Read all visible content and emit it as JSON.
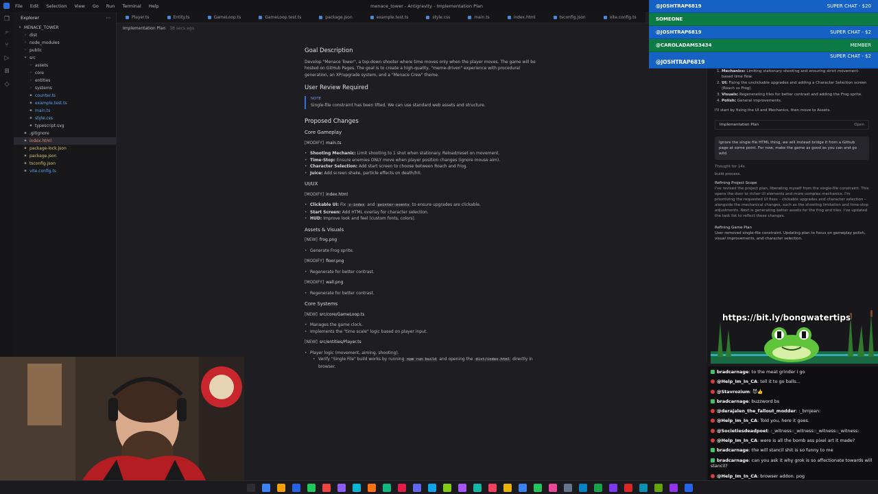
{
  "window": {
    "title": "menace_tower - Antigravity - Implementation Plan",
    "menu": [
      "File",
      "Edit",
      "Selection",
      "View",
      "Go",
      "Run",
      "Terminal",
      "Help"
    ]
  },
  "sidebar": {
    "header": "Explorer",
    "root": "MENACE_TOWER",
    "items": [
      {
        "label": "dist",
        "depth": 1,
        "kind": "folder"
      },
      {
        "label": "node_modules",
        "depth": 1,
        "kind": "folder"
      },
      {
        "label": "public",
        "depth": 1,
        "kind": "folder"
      },
      {
        "label": "src",
        "depth": 1,
        "kind": "folder-open"
      },
      {
        "label": "assets",
        "depth": 2,
        "kind": "folder"
      },
      {
        "label": "core",
        "depth": 2,
        "kind": "folder"
      },
      {
        "label": "entities",
        "depth": 2,
        "kind": "folder"
      },
      {
        "label": "systems",
        "depth": 2,
        "kind": "folder"
      },
      {
        "label": "counter.ts",
        "depth": 2,
        "kind": "ts"
      },
      {
        "label": "example.test.ts",
        "depth": 2,
        "kind": "ts"
      },
      {
        "label": "main.ts",
        "depth": 2,
        "kind": "ts"
      },
      {
        "label": "style.css",
        "depth": 2,
        "kind": "css"
      },
      {
        "label": "typescript.svg",
        "depth": 2,
        "kind": "svg"
      },
      {
        "label": ".gitignore",
        "depth": 1,
        "kind": "file"
      },
      {
        "label": "index.html",
        "depth": 1,
        "kind": "html",
        "selected": true
      },
      {
        "label": "package-lock.json",
        "depth": 1,
        "kind": "json"
      },
      {
        "label": "package.json",
        "depth": 1,
        "kind": "json"
      },
      {
        "label": "tsconfig.json",
        "depth": 1,
        "kind": "json"
      },
      {
        "label": "vite.config.ts",
        "depth": 1,
        "kind": "ts"
      }
    ]
  },
  "tabs": [
    "Player.ts",
    "Entity.ts",
    "GameLoop.ts",
    "GameLoop.test.ts",
    "package.json",
    "example.test.ts",
    "style.css",
    "main.ts",
    "index.html",
    "tsconfig.json",
    "vite.config.ts",
    "Implementation"
  ],
  "active_tab": 11,
  "breadcrumb": {
    "label": "Implementation Plan",
    "ago": "38 secs ago"
  },
  "doc": {
    "goal_title": "Goal Description",
    "goal_text": "Develop \"Menace Tower\", a top-down shooter where time moves only when the player moves. The game will be hosted on GitHub Pages. The goal is to create a high-quality, \"meme-driven\" experience with procedural generation, an XP/upgrade system, and a \"Menace Crew\" theme.",
    "review_title": "User Review Required",
    "note_label": "NOTE",
    "note_text": "Single-file constraint has been lifted. We can use standard web assets and structure.",
    "proposed_title": "Proposed Changes",
    "core_title": "Core Gameplay",
    "core_mod": {
      "tag": "[MODIFY]",
      "file": "main.ts"
    },
    "core_items": [
      {
        "b": "Shooting Mechanic:",
        "t": " Limit shooting to 1 shot when stationary. Reload/reset on movement."
      },
      {
        "b": "Time-Stop:",
        "t": " Ensure enemies ONLY move when player position changes (ignore mouse aim)."
      },
      {
        "b": "Character Selection:",
        "t": " Add start screen to choose between Roach and Frog."
      },
      {
        "b": "Juice:",
        "t": " Add screen shake, particle effects on death/hit."
      }
    ],
    "ui_title": "UI/UX",
    "ui_mod": {
      "tag": "[MODIFY]",
      "file": "index.html"
    },
    "ui_items": [
      {
        "b": "Clickable UI:",
        "t1": " Fix ",
        "c1": "z-index",
        "t2": " and ",
        "c2": "pointer-events",
        "t3": " to ensure upgrades are clickable."
      },
      {
        "b": "Start Screen:",
        "t": " Add HTML overlay for character selection."
      },
      {
        "b": "HUD:",
        "t": " Improve look and feel (custom fonts, colors)."
      }
    ],
    "assets_title": "Assets & Visuals",
    "assets": [
      {
        "tag": "[NEW]",
        "file": "frog.png",
        "item": "Generate Frog sprite."
      },
      {
        "tag": "[MODIFY]",
        "file": "floor.png",
        "item": "Regenerate for better contrast."
      },
      {
        "tag": "[MODIFY]",
        "file": "wall.png",
        "item": "Regenerate for better contrast."
      }
    ],
    "systems_title": "Core Systems",
    "gameloop": {
      "tag": "[NEW]",
      "file": "src/core/GameLoop.ts",
      "items": [
        "Manages the game clock.",
        "Implements the \"time scale\" logic based on player input."
      ]
    },
    "player": {
      "tag": "[NEW]",
      "file": "src/entities/Player.ts",
      "item": "Player logic (movement, aiming, shooting)."
    },
    "verify": {
      "t1": "Verify \"Single File\" build works by running ",
      "c": "npm run build",
      "t2": " and opening the ",
      "file": "dist/index.html",
      "t3": " directly in browser."
    }
  },
  "agent": {
    "steps": [
      {
        "b": "Mechanics:",
        "t": " Limiting stationary shooting and ensuring strict movement-based time flow."
      },
      {
        "b": "UI:",
        "t": " Fixing the unclickable upgrades and adding a Character Selection screen (Roach vs Frog)."
      },
      {
        "b": "Visuals:",
        "t": " Regenerating tiles for better contrast and adding the Frog sprite."
      },
      {
        "b": "Polish:",
        "t": " General improvements."
      }
    ],
    "closing": "I'll start by fixing the UI and Mechanics, then move to Assets.",
    "card_label": "Implementation Plan",
    "card_open": "Open",
    "user_msg": "Ignore the single file HTML thing, we will instead bridge it from a Github page at some point. For now, make the game as good as you can and go wild.",
    "thought": "Thought for 14s",
    "build_text": "build process.",
    "refine_scope_title": "Refining Project Scope",
    "refine_scope_text": "I've revised the project plan, liberating myself from the single-file constraint. This opens the door to richer UI elements and more complex mechanics. I'm prioritizing the requested UI fixes – clickable upgrades and character selection – alongside the mechanical changes, such as the shooting limitation and time-stop adjustments. Next is generating better assets for the frog and tiles. I've updated the task list to reflect these changes.",
    "refine_plan_title": "Refining Game Plan",
    "refine_plan_text": "User removed single-file constraint. Updating plan to focus on gameplay polish, visual improvements, and character selection."
  },
  "superchats": [
    {
      "name": "@JOSHTRAP6819",
      "label": "SUPER CHAT - $20",
      "kind": "super"
    },
    {
      "name": "SOMEONE",
      "label": "",
      "kind": "member"
    },
    {
      "name": "@JOSHTRAP6819",
      "label": "SUPER CHAT - $2",
      "kind": "super"
    },
    {
      "name": "@CAROLADAMS3434",
      "label": "MEMBER",
      "kind": "member"
    },
    {
      "name": "@JOSHTRAP6819",
      "label": "SUPER CHAT - $2",
      "kind": "super-tall"
    }
  ],
  "banner": {
    "url": "https://bit.ly/bongwatertips"
  },
  "chat": [
    {
      "u": "bradcarnage",
      "m": ": to the meat grinder i go",
      "badge": "g"
    },
    {
      "u": "@Help_Im_In_CA",
      "m": ": tell it to go balls...",
      "badge": "r"
    },
    {
      "u": "@Stavrozium",
      "m": ": 😈👍",
      "badge": "r"
    },
    {
      "u": "bradcarnage",
      "m": ": buzzword bs",
      "badge": "g"
    },
    {
      "u": "@derajalen_the_fallout_modder",
      "m": ": :_bmjean:",
      "badge": "r"
    },
    {
      "u": "@Help_Im_In_CA",
      "m": ": Told you, here it goes.",
      "badge": "r"
    },
    {
      "u": "@Societiesdeadpoet",
      "m": ": :_witness::_witness::_witness::_witness:",
      "badge": "r"
    },
    {
      "u": "@Help_Im_In_CA",
      "m": ": were is all the bomb ass pixel art it made?",
      "badge": "r"
    },
    {
      "u": "bradcarnage",
      "m": ": the will stancil shit is so funny to me",
      "badge": "g"
    },
    {
      "u": "bradcarnage",
      "m": ": can you ask it why grok is so affectionate towards will stancil?",
      "badge": "g"
    },
    {
      "u": "@Help_Im_In_CA",
      "m": ": browser addon. pog",
      "badge": "r"
    }
  ]
}
